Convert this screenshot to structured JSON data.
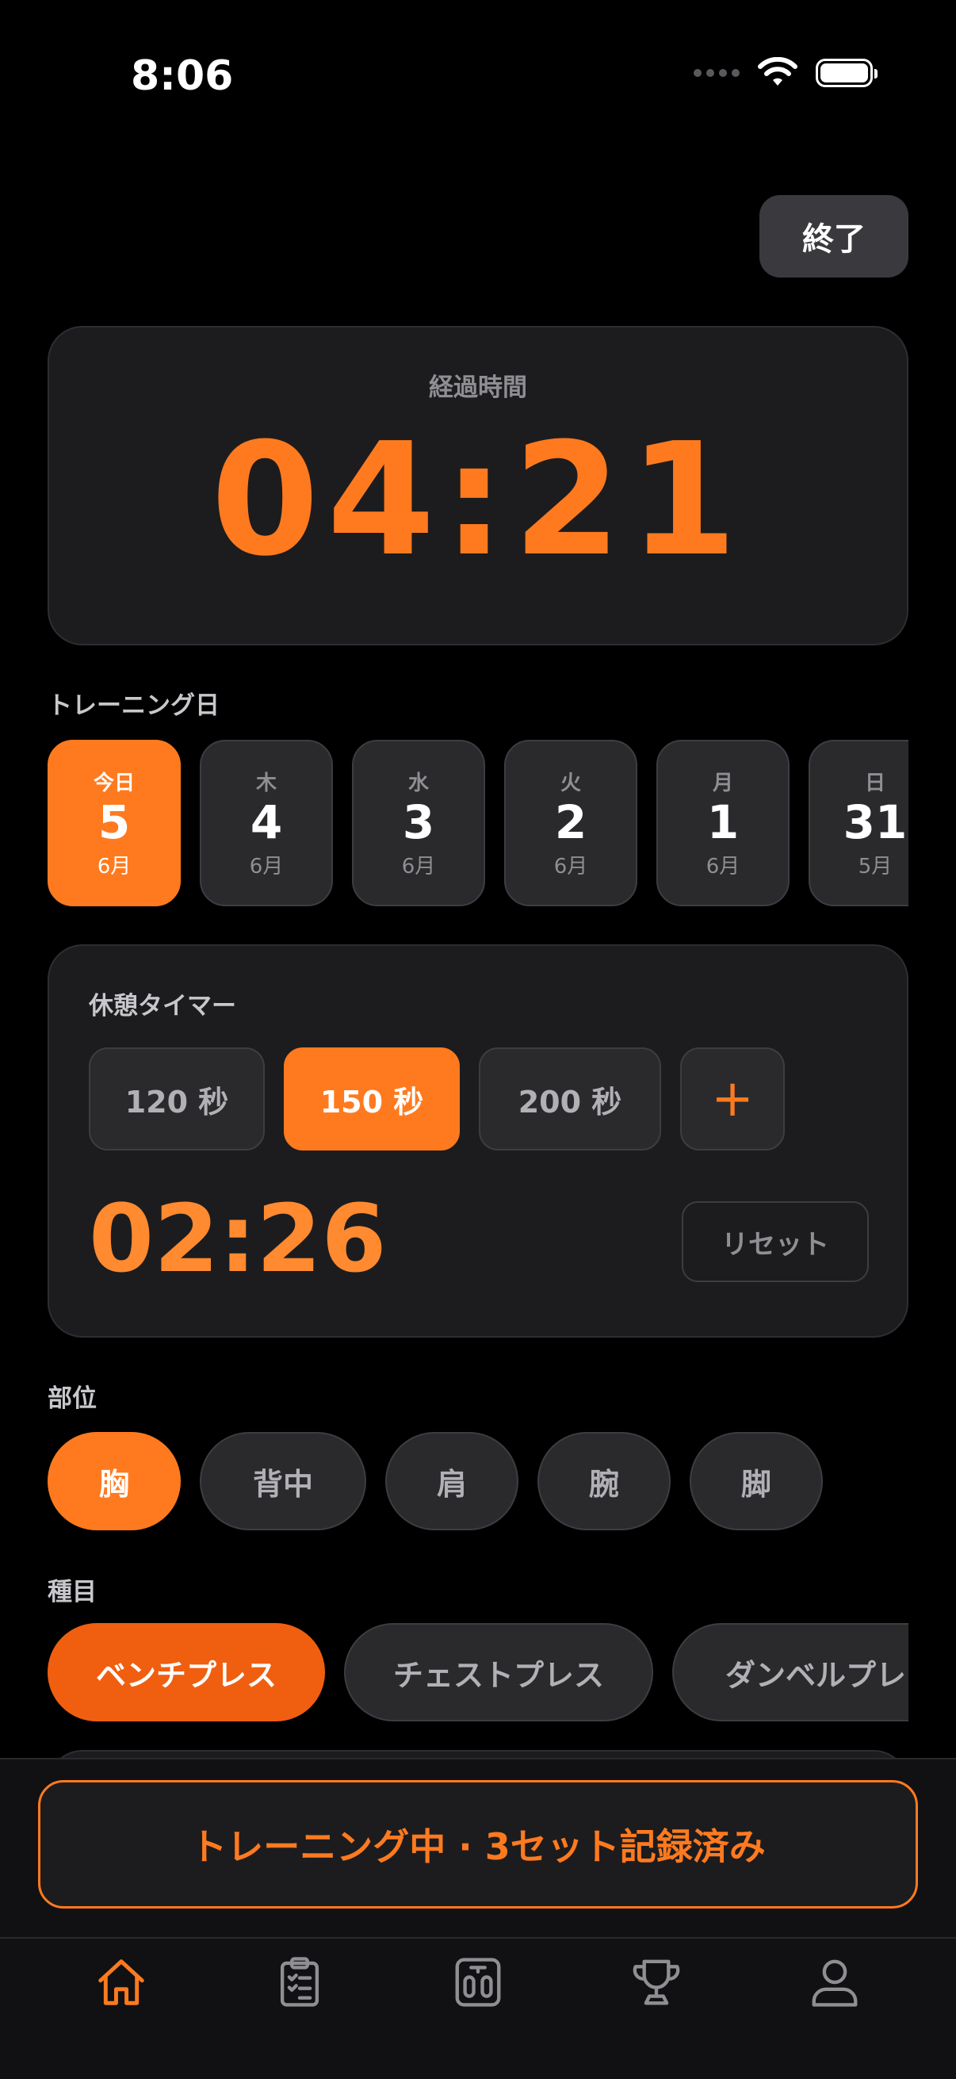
{
  "status_bar": {
    "time": "8:06"
  },
  "header": {
    "end_label": "終了"
  },
  "elapsed": {
    "label": "経過時間",
    "value": "04:21"
  },
  "training_days": {
    "label": "トレーニング日",
    "days": [
      {
        "dow": "今日",
        "day": "5",
        "month": "6月",
        "active": true
      },
      {
        "dow": "木",
        "day": "4",
        "month": "6月",
        "active": false
      },
      {
        "dow": "水",
        "day": "3",
        "month": "6月",
        "active": false
      },
      {
        "dow": "火",
        "day": "2",
        "month": "6月",
        "active": false
      },
      {
        "dow": "月",
        "day": "1",
        "month": "6月",
        "active": false
      },
      {
        "dow": "日",
        "day": "31",
        "month": "5月",
        "active": false
      }
    ]
  },
  "rest_timer": {
    "title": "休憩タイマー",
    "presets": [
      {
        "label": "120 秒",
        "active": false
      },
      {
        "label": "150 秒",
        "active": true
      },
      {
        "label": "200 秒",
        "active": false
      }
    ],
    "add_label": "+",
    "value": "02:26",
    "reset_label": "リセット"
  },
  "body_parts": {
    "label": "部位",
    "items": [
      {
        "label": "胸",
        "active": true
      },
      {
        "label": "背中",
        "active": false
      },
      {
        "label": "肩",
        "active": false
      },
      {
        "label": "腕",
        "active": false
      },
      {
        "label": "脚",
        "active": false
      }
    ]
  },
  "exercises": {
    "label": "種目",
    "items": [
      {
        "label": "ベンチプレス",
        "active": true
      },
      {
        "label": "チェストプレス",
        "active": false
      },
      {
        "label": "ダンベルプレス",
        "active": false
      }
    ]
  },
  "training_status": "トレーニング中 · 3セット記録済み",
  "tab_bar": {
    "active_index": 0,
    "tabs": [
      {
        "icon": "home-icon"
      },
      {
        "icon": "clipboard-icon"
      },
      {
        "icon": "scale-icon"
      },
      {
        "icon": "trophy-icon"
      },
      {
        "icon": "profile-icon"
      }
    ]
  },
  "colors": {
    "accent": "#ff7a1f",
    "background": "#000000",
    "card": "#1c1c1e",
    "inactive": "#2a2a2d",
    "tab_inactive": "#8e8e93"
  }
}
